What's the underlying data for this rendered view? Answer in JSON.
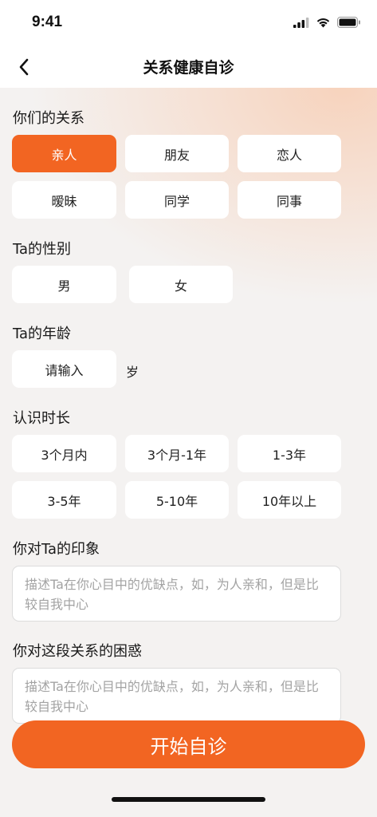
{
  "status_bar": {
    "time": "9:41"
  },
  "nav": {
    "title": "关系健康自诊"
  },
  "sections": {
    "relation": {
      "title": "你们的关系",
      "options": [
        "亲人",
        "朋友",
        "恋人",
        "暧昧",
        "同学",
        "同事"
      ],
      "selected": "亲人"
    },
    "gender": {
      "title": "Ta的性别",
      "options": [
        "男",
        "女"
      ]
    },
    "age": {
      "title": "Ta的年龄",
      "placeholder": "请输入",
      "unit": "岁"
    },
    "duration": {
      "title": "认识时长",
      "options": [
        "3个月内",
        "3个月-1年",
        "1-3年",
        "3-5年",
        "5-10年",
        "10年以上"
      ]
    },
    "impression": {
      "title": "你对Ta的印象",
      "placeholder": "描述Ta在你心目中的优缺点，如，为人亲和，但是比较自我中心"
    },
    "confusion": {
      "title": "你对这段关系的困惑",
      "placeholder": "描述Ta在你心目中的优缺点，如，为人亲和，但是比较自我中心"
    }
  },
  "start_button": {
    "label": "开始自诊"
  },
  "colors": {
    "accent": "#f26522",
    "background": "#f4f2f1",
    "chip": "#ffffff"
  }
}
